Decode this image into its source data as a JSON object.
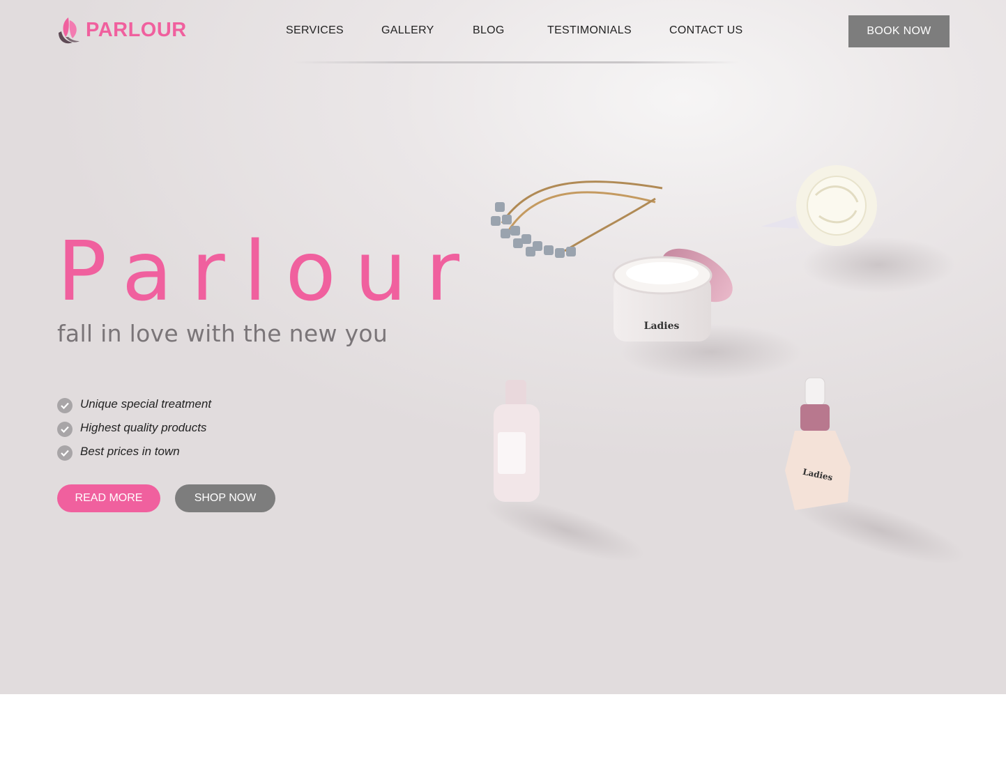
{
  "brand": {
    "logo_text": "PARLOUR",
    "logo_icon": "butterfly-icon",
    "accent": "#f0609e"
  },
  "nav": {
    "items": [
      "SERVICES",
      "GALLERY",
      "BLOG",
      "TESTIMONIALS",
      "CONTACT US"
    ],
    "book_label": "BOOK NOW"
  },
  "hero": {
    "title": "Parlour",
    "subtitle": "fall in love with the new you",
    "features": [
      "Unique special treatment",
      "Highest quality products",
      "Best prices in town"
    ],
    "feature_icon": "check-circle-icon",
    "read_more_label": "READ MORE",
    "shop_now_label": "SHOP NOW",
    "product_label": "Ladies"
  },
  "colors": {
    "pink": "#f0609e",
    "grey_button": "#7d7d7d",
    "background": "#e6e1e2"
  }
}
